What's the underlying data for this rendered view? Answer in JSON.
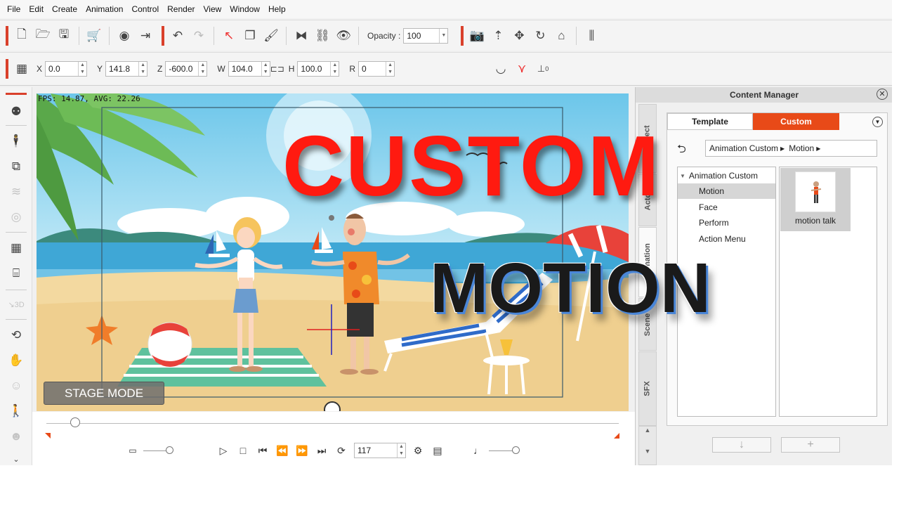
{
  "menu": [
    "File",
    "Edit",
    "Create",
    "Animation",
    "Control",
    "Render",
    "View",
    "Window",
    "Help"
  ],
  "toolbar": {
    "opacity_label": "Opacity :",
    "opacity_value": "100",
    "icons": [
      "new-file-icon",
      "open-folder-icon",
      "save-icon",
      "cart-icon",
      "preview-icon",
      "export-icon",
      "undo-icon",
      "redo-icon",
      "select-arrow-icon",
      "copy-icon",
      "paint-icon",
      "flip-icon",
      "link-icon",
      "eye-icon",
      "camera-icon",
      "move-up-icon",
      "move-icon",
      "rotate-icon",
      "home-icon",
      "align-icon"
    ]
  },
  "transform": {
    "x_label": "X",
    "x_value": "0.0",
    "y_label": "Y",
    "y_value": "141.8",
    "z_label": "Z",
    "z_value": "-600.0",
    "w_label": "W",
    "w_value": "104.0",
    "h_label": "H",
    "h_value": "100.0",
    "r_label": "R",
    "r_value": "0",
    "anchor_value": "0"
  },
  "stage": {
    "fps_text": "FPS: 14.87, AVG: 22.26",
    "mode_button": "STAGE MODE"
  },
  "timeline": {
    "frame_value": "117",
    "scrub_position": 0.05
  },
  "content_manager": {
    "title": "Content Manager",
    "side_tabs": [
      "Project",
      "Actor",
      "Animation",
      "Scene",
      "SFX"
    ],
    "tab_template": "Template",
    "tab_custom": "Custom",
    "breadcrumb": [
      "Animation Custom",
      "Motion"
    ],
    "tree_root": "Animation Custom",
    "tree_items": [
      "Motion",
      "Face",
      "Perform",
      "Action Menu"
    ],
    "selected_item": "Motion",
    "tile_label": "motion talk",
    "download_button": "↓",
    "add_button": "+"
  },
  "overlay": {
    "title_line1": "CUSTOM",
    "title_line2": "MOTION"
  },
  "colors": {
    "accent": "#e84a18",
    "toolbar_red": "#d9402b",
    "title_red": "#ff1a10",
    "sky": "#8fd3ec",
    "sand": "#f3d9a0",
    "sea": "#3fa7d6"
  }
}
